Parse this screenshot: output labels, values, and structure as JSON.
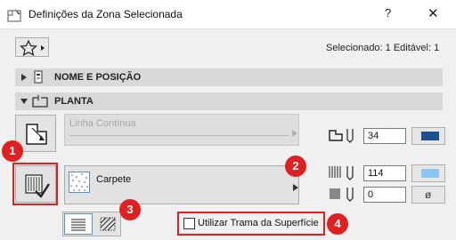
{
  "window": {
    "title": "Definições da Zona Selecionada",
    "help_label": "?",
    "close_label": "✕"
  },
  "toolbar": {
    "selection_info": "Selecionado: 1 Editável: 1"
  },
  "sections": [
    {
      "label": "NOME E POSIÇÃO",
      "expanded": false
    },
    {
      "label": "PLANTA",
      "expanded": true
    }
  ],
  "plan": {
    "line_type": "Linha Contínua",
    "fill": "Carpete",
    "surface_checkbox_label": "Utilizar Trama da Superfície",
    "surface_checkbox_checked": false
  },
  "pens": [
    {
      "value": "34",
      "color": "#1f4e8c"
    },
    {
      "value": "114",
      "color": "#8fc3f2"
    },
    {
      "value": "0",
      "symbol": "ø"
    }
  ],
  "callouts": [
    "1",
    "2",
    "3",
    "4"
  ],
  "colors": {
    "callout": "#e02020",
    "accent": "#5a8fc6"
  }
}
